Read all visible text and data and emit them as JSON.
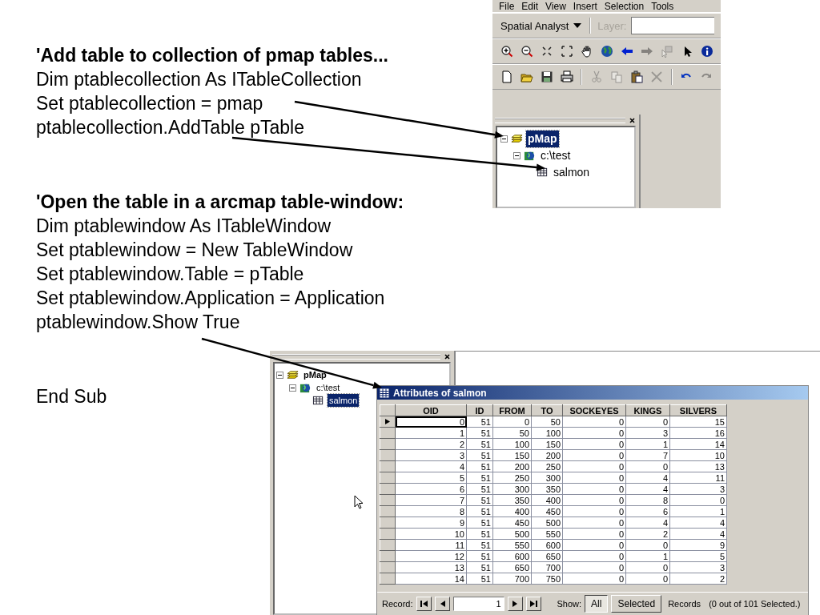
{
  "code_blocks": [
    {
      "heading": "'Add table to collection of pmap tables...",
      "lines": [
        "Dim ptablecollection As ITableCollection",
        "Set ptablecollection = pmap",
        "ptablecollection.AddTable pTable"
      ]
    },
    {
      "heading": "'Open the table in a arcmap table-window:",
      "lines": [
        "Dim ptablewindow As ITableWindow",
        "Set ptablewindow = New TableWindow",
        "Set ptablewindow.Table = pTable",
        "Set ptablewindow.Application = Application",
        "ptablewindow.Show True"
      ]
    }
  ],
  "end_line": "End Sub",
  "top_screenshot": {
    "menu": [
      "File",
      "Edit",
      "View",
      "Insert",
      "Selection",
      "Tools"
    ],
    "dropdown": "Spatial Analyst",
    "layer_label": "Layer:",
    "layer_disabled": true,
    "tool_rows": [
      [
        {
          "kind": "zoom-in",
          "disabled": false
        },
        {
          "kind": "zoom-out",
          "disabled": false
        },
        {
          "kind": "fixed-zoom-in",
          "disabled": false
        },
        {
          "kind": "fixed-zoom-out",
          "disabled": false
        },
        {
          "kind": "pan",
          "disabled": false
        },
        {
          "kind": "globe",
          "disabled": false
        },
        {
          "kind": "back",
          "disabled": false
        },
        {
          "kind": "forward",
          "disabled": true
        },
        {
          "kind": "select-elements",
          "disabled": true
        },
        {
          "kind": "pointer",
          "disabled": false
        },
        {
          "kind": "identify",
          "disabled": false
        }
      ],
      [
        {
          "kind": "new",
          "disabled": false
        },
        {
          "kind": "open",
          "disabled": false
        },
        {
          "kind": "save",
          "disabled": false
        },
        {
          "kind": "print",
          "disabled": false
        },
        {
          "kind": "cut",
          "disabled": true
        },
        {
          "kind": "copy",
          "disabled": true
        },
        {
          "kind": "paste",
          "disabled": false
        },
        {
          "kind": "delete",
          "disabled": true
        },
        {
          "kind": "undo",
          "disabled": false
        },
        {
          "kind": "redo",
          "disabled": true
        }
      ]
    ],
    "tree": [
      {
        "label": "pMap",
        "kind": "map",
        "selected": true,
        "expanded": true,
        "children": [
          {
            "label": "c:\\test",
            "kind": "workspace",
            "selected": false,
            "expanded": true,
            "children": [
              {
                "label": "salmon",
                "kind": "table",
                "selected": false
              }
            ]
          }
        ]
      }
    ]
  },
  "bottom_screenshot": {
    "tree": [
      {
        "label": "pMap",
        "kind": "map",
        "selected": false,
        "expanded": true,
        "children": [
          {
            "label": "c:\\test",
            "kind": "workspace",
            "selected": false,
            "expanded": true,
            "children": [
              {
                "label": "salmon",
                "kind": "table",
                "selected": true
              }
            ]
          }
        ]
      }
    ],
    "table_window": {
      "title": "Attributes of salmon",
      "columns": [
        "OID",
        "ID",
        "FROM",
        "TO",
        "SOCKEYES",
        "KINGS",
        "SILVERS"
      ],
      "rows": [
        {
          "selected": true,
          "cells": [
            "0",
            "51",
            "0",
            "50",
            "0",
            "0",
            "15"
          ]
        },
        {
          "selected": false,
          "cells": [
            "1",
            "51",
            "50",
            "100",
            "0",
            "3",
            "16"
          ]
        },
        {
          "selected": false,
          "cells": [
            "2",
            "51",
            "100",
            "150",
            "0",
            "1",
            "14"
          ]
        },
        {
          "selected": false,
          "cells": [
            "3",
            "51",
            "150",
            "200",
            "0",
            "7",
            "10"
          ]
        },
        {
          "selected": false,
          "cells": [
            "4",
            "51",
            "200",
            "250",
            "0",
            "0",
            "13"
          ]
        },
        {
          "selected": false,
          "cells": [
            "5",
            "51",
            "250",
            "300",
            "0",
            "4",
            "11"
          ]
        },
        {
          "selected": false,
          "cells": [
            "6",
            "51",
            "300",
            "350",
            "0",
            "4",
            "3"
          ]
        },
        {
          "selected": false,
          "cells": [
            "7",
            "51",
            "350",
            "400",
            "0",
            "8",
            "0"
          ]
        },
        {
          "selected": false,
          "cells": [
            "8",
            "51",
            "400",
            "450",
            "0",
            "6",
            "1"
          ]
        },
        {
          "selected": false,
          "cells": [
            "9",
            "51",
            "450",
            "500",
            "0",
            "4",
            "4"
          ]
        },
        {
          "selected": false,
          "cells": [
            "10",
            "51",
            "500",
            "550",
            "0",
            "2",
            "4"
          ]
        },
        {
          "selected": false,
          "cells": [
            "11",
            "51",
            "550",
            "600",
            "0",
            "0",
            "9"
          ]
        },
        {
          "selected": false,
          "cells": [
            "12",
            "51",
            "600",
            "650",
            "0",
            "1",
            "5"
          ]
        },
        {
          "selected": false,
          "cells": [
            "13",
            "51",
            "650",
            "700",
            "0",
            "0",
            "3"
          ]
        },
        {
          "selected": false,
          "cells": [
            "14",
            "51",
            "700",
            "750",
            "0",
            "0",
            "2"
          ]
        }
      ],
      "footer": {
        "record_label": "Record:",
        "record_value": "1",
        "show_label": "Show:",
        "show_options": [
          {
            "label": "All",
            "selected": true
          },
          {
            "label": "Selected",
            "selected": false
          }
        ],
        "records_label": "Records",
        "records_status": "(0 out of 101 Selected.)"
      }
    }
  }
}
